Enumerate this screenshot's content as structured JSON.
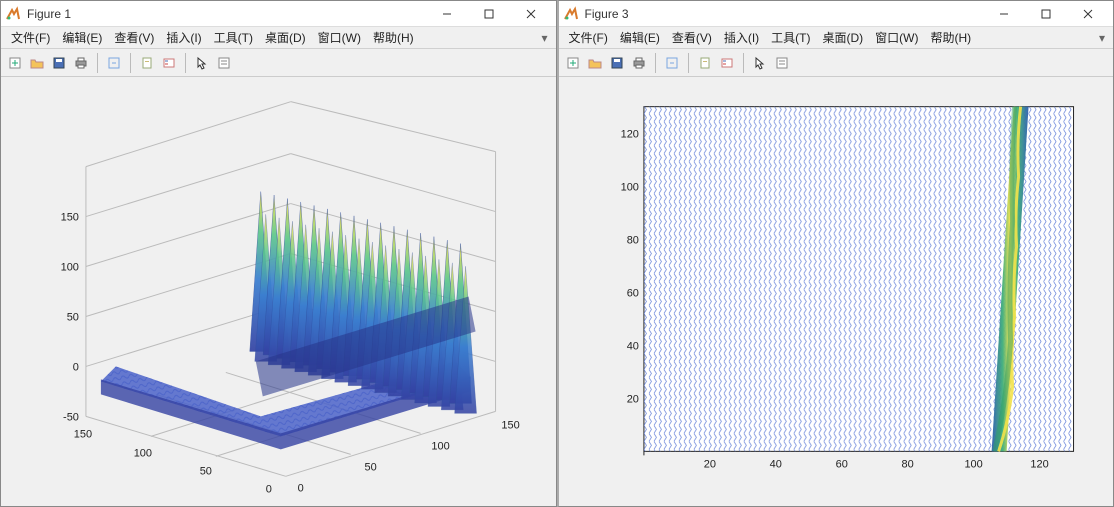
{
  "figures": [
    {
      "title": "Figure 1"
    },
    {
      "title": "Figure 3"
    }
  ],
  "menu": {
    "file": "文件(F)",
    "edit": "编辑(E)",
    "view": "查看(V)",
    "insert": "插入(I)",
    "tools": "工具(T)",
    "desktop": "桌面(D)",
    "window": "窗口(W)",
    "help": "帮助(H)"
  },
  "icons": {
    "new": "new-figure-icon",
    "open": "open-icon",
    "save": "save-icon",
    "print": "print-icon",
    "link": "link-icon",
    "datacursor": "datacursor-icon",
    "legend": "legend-icon",
    "pointer": "pointer-icon",
    "insert": "insert-icon"
  },
  "chart_data": [
    {
      "type": "surface",
      "title": "",
      "xlabel": "",
      "ylabel": "",
      "zlabel": "",
      "x_range": [
        0,
        150
      ],
      "y_range": [
        0,
        150
      ],
      "z_range": [
        -50,
        150
      ],
      "x_ticks": [
        0,
        50,
        100,
        150
      ],
      "y_ticks": [
        0,
        50,
        100,
        150
      ],
      "z_ticks": [
        -50,
        0,
        50,
        100,
        150
      ],
      "description": "3D surface over a 150x150 grid. For y roughly < 90 the surface is low-amplitude ripple near z≈0 (slightly below). For y roughly ≥ 90 there is a ridge of tall oscillatory peaks spanning all x, peaks reaching about z≈130–150, with small negative troughs around z≈-40 to -50 near the ridge front.",
      "approx_profile_along_y": {
        "y": [
          0,
          20,
          40,
          60,
          80,
          90,
          100,
          120,
          140,
          150
        ],
        "z_peak": [
          5,
          5,
          5,
          5,
          5,
          40,
          130,
          140,
          140,
          140
        ],
        "z_trough": [
          -10,
          -10,
          -10,
          -10,
          -10,
          -20,
          -40,
          -45,
          -45,
          -45
        ]
      }
    },
    {
      "type": "heatmap",
      "title": "",
      "xlabel": "",
      "ylabel": "",
      "x_range": [
        0,
        130
      ],
      "y_range": [
        0,
        130
      ],
      "x_ticks": [
        20,
        40,
        60,
        80,
        100,
        120
      ],
      "y_ticks": [
        20,
        40,
        60,
        80,
        100,
        120
      ],
      "description": "Image/heatmap on ~130x130 grid. Background is fine blue hatch (≈0). A single narrow high-intensity diagonal streak (yellow-green, high value) runs near x≈110–118, slanting slightly so that at y=0 it is at x≈117 and at y=130 it is at x≈110.",
      "streak_line": {
        "y": [
          0,
          130
        ],
        "x": [
          117,
          110
        ],
        "value": 140
      },
      "background_value": 0
    }
  ]
}
